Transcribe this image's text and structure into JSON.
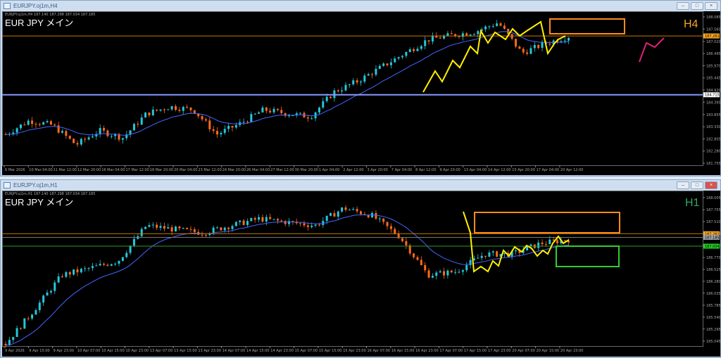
{
  "windows": [
    {
      "title": "EURJPY.oj1m,H4",
      "info": "EURJPY.oj1m,H4  187.140 187.298 187.034 187.185",
      "symbol_label": "EUR JPY  メイン",
      "timeframe": "H4",
      "tf_color": "#f5a623",
      "price_ticks": [
        "188.085",
        "187.560",
        "187.020",
        "186.495",
        "185.970",
        "185.445",
        "184.920",
        "184.395",
        "183.855",
        "183.330",
        "182.805",
        "182.280",
        "181.755"
      ],
      "price_range": [
        181.755,
        188.085
      ],
      "price_labels": [
        {
          "text": "187.261",
          "color": "#f5a623"
        },
        {
          "text": "184.715",
          "color": "#ffffff"
        }
      ],
      "time_ticks": [
        "6 Mar 2026",
        "10 Mar 04:00",
        "11 Mar 12:00",
        "12 Mar 20:00",
        "16 Mar 04:00",
        "17 Mar 12:00",
        "18 Mar 20:00",
        "20 Mar 04:00",
        "23 Mar 12:00",
        "24 Mar 20:00",
        "26 Mar 04:00",
        "27 Mar 12:00",
        "30 Mar 20:00",
        "1 Apr 04:00",
        "2 Apr 12:00",
        "3 Apr 20:00",
        "7 Apr 04:00",
        "8 Apr 12:00",
        "9 Apr 20:00",
        "13 Apr 04:00",
        "14 Apr 12:00",
        "15 Apr 20:00",
        "17 Apr 04:00",
        "20 Apr 12:00"
      ]
    },
    {
      "title": "EURJPY.oj1m,H1",
      "info": "EURJPY.oj1m,H1  187.140 187.298 187.034 187.185",
      "symbol_label": "EUR JPY  メイン",
      "timeframe": "H1",
      "tf_color": "#2eaa5c",
      "price_ticks": [
        "188.005",
        "187.755",
        "187.510",
        "187.265",
        "187.020",
        "186.770",
        "186.525",
        "186.280",
        "186.035",
        "185.785",
        "185.540",
        "185.295",
        "185.045"
      ],
      "price_range": [
        185.045,
        188.005
      ],
      "price_labels": [
        {
          "text": "187.261",
          "color": "#f5a623"
        },
        {
          "text": "187.185",
          "color": "#9aa0a6"
        },
        {
          "text": "187.004",
          "color": "#22cc22"
        }
      ],
      "time_ticks": [
        "9 Apr 2026",
        "9 Apr 15:00",
        "9 Apr 23:00",
        "10 Apr 07:00",
        "10 Apr 15:00",
        "10 Apr 23:00",
        "13 Apr 07:00",
        "13 Apr 15:00",
        "13 Apr 23:00",
        "14 Apr 07:00",
        "14 Apr 15:00",
        "14 Apr 23:00",
        "15 Apr 07:00",
        "15 Apr 15:00",
        "15 Apr 23:00",
        "16 Apr 07:00",
        "16 Apr 15:00",
        "16 Apr 23:00",
        "17 Apr 07:00",
        "17 Apr 15:00",
        "17 Apr 23:00",
        "20 Apr 07:00",
        "20 Apr 15:00",
        "20 Apr 23:00"
      ]
    }
  ],
  "chart_data": [
    {
      "type": "candlestick",
      "title": "EURJPY H4",
      "path_close": [
        183.0,
        183.6,
        183.4,
        182.55,
        183.16,
        182.85,
        183.9,
        184.2,
        184.07,
        183.0,
        183.47,
        184.07,
        183.9,
        183.77,
        184.84,
        185.3,
        185.9,
        186.5,
        187.1,
        187.29,
        187.44,
        187.84,
        186.52,
        186.93,
        187.24
      ],
      "bull_color": "#26c6da",
      "bear_color": "#ff6a1a",
      "ma_color": "#4466ff"
    },
    {
      "type": "candlestick",
      "title": "EURJPY H1",
      "path_close": [
        184.99,
        185.68,
        186.41,
        186.55,
        186.7,
        187.43,
        187.35,
        187.28,
        187.43,
        187.57,
        187.5,
        187.43,
        187.79,
        187.64,
        187.2,
        186.41,
        186.48,
        186.84,
        186.84,
        187.06,
        187.14
      ],
      "bull_color": "#26c6da",
      "bear_color": "#ff6a1a",
      "ma_color": "#4466ff"
    }
  ]
}
